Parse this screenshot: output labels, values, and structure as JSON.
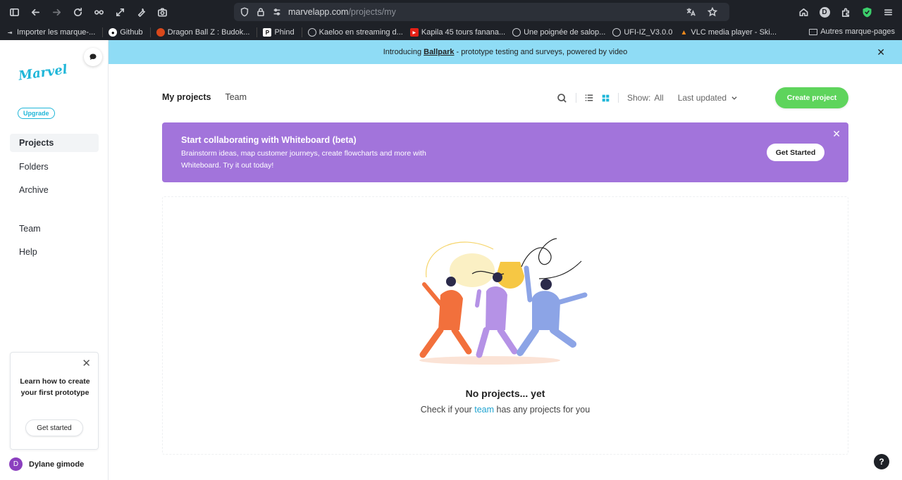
{
  "browser": {
    "url_host": "marvelapp.com",
    "url_path": "/projects/my",
    "bookmarks": [
      {
        "label": "Importer les marque-..."
      },
      {
        "label": "Github"
      },
      {
        "label": "Dragon Ball Z : Budok..."
      },
      {
        "label": "Phind"
      },
      {
        "label": "Kaeloo en streaming d..."
      },
      {
        "label": "Kapila 45 tours fanana..."
      },
      {
        "label": "Une poignée de salop..."
      },
      {
        "label": "UFI-IZ_V3.0.0"
      },
      {
        "label": "VLC media player - Ski..."
      }
    ],
    "other_bookmarks": "Autres marque-pages",
    "profile_letter": "D"
  },
  "announcement": {
    "prefix": "Introducing",
    "link": "Ballpark",
    "suffix": "- prototype testing and surveys, powered by video"
  },
  "sidebar": {
    "logo": "Marvel",
    "upgrade": "Upgrade",
    "items": [
      {
        "label": "Projects"
      },
      {
        "label": "Folders"
      },
      {
        "label": "Archive"
      },
      {
        "label": "Team"
      },
      {
        "label": "Help"
      }
    ],
    "learn_card": {
      "text": "Learn how to create your first prototype",
      "button": "Get started"
    },
    "user": {
      "initial": "D",
      "name": "Dylane gimode"
    }
  },
  "main": {
    "tabs": [
      {
        "label": "My projects"
      },
      {
        "label": "Team"
      }
    ],
    "show_label": "Show:",
    "show_value": "All",
    "sort_label": "Last updated",
    "create_button": "Create project",
    "banner": {
      "title": "Start collaborating with Whiteboard (beta)",
      "description": "Brainstorm ideas, map customer journeys, create flowcharts and more with Whiteboard. Try it out today!",
      "button": "Get Started"
    },
    "empty": {
      "title": "No projects... yet",
      "sub_prefix": "Check if your",
      "sub_link": "team",
      "sub_suffix": "has any projects for you"
    }
  },
  "colors": {
    "accent": "#1fb6d8",
    "create": "#5ed45c",
    "banner": "#a274db",
    "announce": "#8fdcf5"
  }
}
